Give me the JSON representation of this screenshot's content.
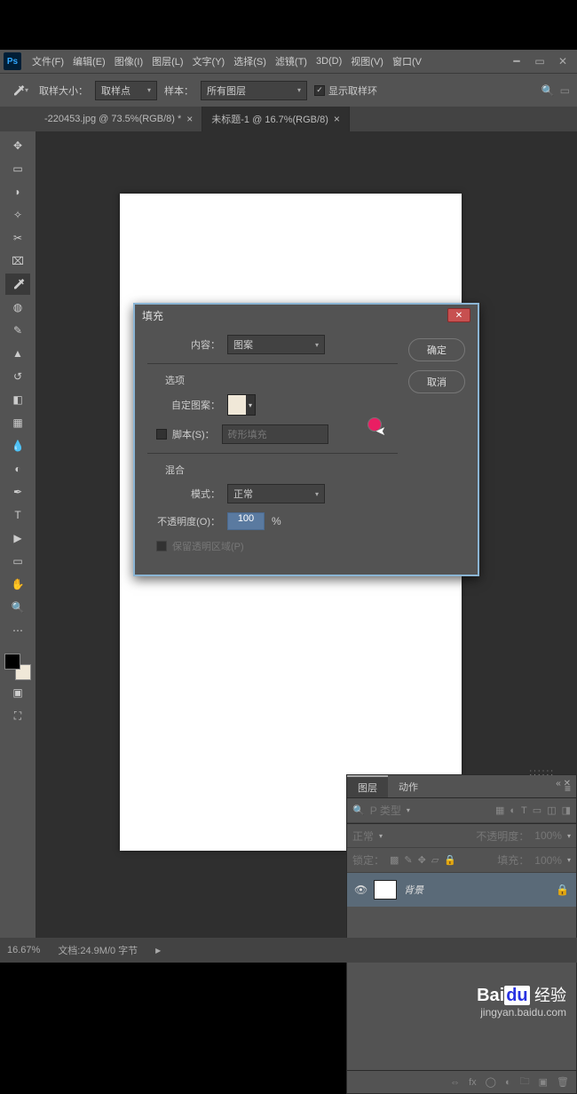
{
  "menu": {
    "file": "文件(F)",
    "edit": "编辑(E)",
    "image": "图像(I)",
    "layer": "图层(L)",
    "type": "文字(Y)",
    "select": "选择(S)",
    "filter": "滤镜(T)",
    "3d": "3D(D)",
    "view": "视图(V)",
    "window": "窗口(V"
  },
  "options": {
    "sample_size_label": "取样大小：",
    "sample_size_value": "取样点",
    "sample_label": "样本：",
    "sample_value": "所有图层",
    "show_ring_label": "显示取样环"
  },
  "tabs": {
    "tab1": "-220453.jpg @ 73.5%(RGB/8) *",
    "tab2": "未标题-1 @ 16.7%(RGB/8)"
  },
  "dialog": {
    "title": "填充",
    "content_label": "内容：",
    "content_value": "图案",
    "options_label": "选项",
    "pattern_label": "自定图案：",
    "script_label": "脚本(S)：",
    "script_value": "砖形填充",
    "blend_label": "混合",
    "mode_label": "模式：",
    "mode_value": "正常",
    "opacity_label": "不透明度(O)：",
    "opacity_value": "100",
    "opacity_unit": "%",
    "preserve_label": "保留透明区域(P)",
    "ok": "确定",
    "cancel": "取消"
  },
  "layers_panel": {
    "tab_layers": "图层",
    "tab_actions": "动作",
    "kind_label": "类型",
    "blend_mode": "正常",
    "opacity_label": "不透明度：",
    "opacity_value": "100%",
    "lock_label": "锁定：",
    "fill_label": "填充：",
    "fill_value": "100%",
    "layer1_name": "背景",
    "search_placeholder": "P 类型"
  },
  "status": {
    "zoom": "16.67%",
    "doc_info": "文档:24.9M/0 字节"
  },
  "watermark": {
    "brand": "Bai",
    "brand2": "经验",
    "url": "jingyan.baidu.com"
  }
}
